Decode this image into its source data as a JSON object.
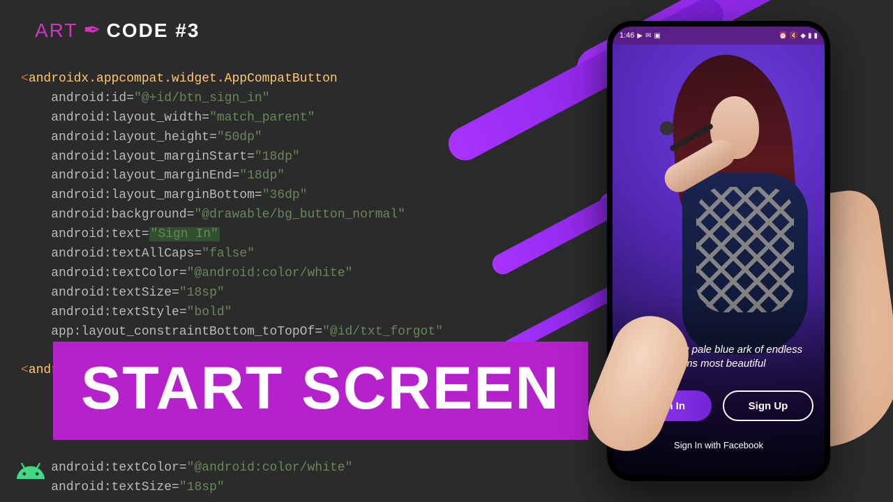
{
  "logo": {
    "art": "ART",
    "code": "CODE #3"
  },
  "code": {
    "open_tag": "androidx.appcompat.widget.AppCompatButton",
    "attrs": [
      {
        "name": "android:id",
        "value": "\"@+id/btn_sign_in\""
      },
      {
        "name": "android:layout_width",
        "value": "\"match_parent\""
      },
      {
        "name": "android:layout_height",
        "value": "\"50dp\""
      },
      {
        "name": "android:layout_marginStart",
        "value": "\"18dp\""
      },
      {
        "name": "android:layout_marginEnd",
        "value": "\"18dp\""
      },
      {
        "name": "android:layout_marginBottom",
        "value": "\"36dp\""
      },
      {
        "name": "android:background",
        "value": "\"@drawable/bg_button_normal\""
      },
      {
        "name": "android:text",
        "value": "\"Sign In\"",
        "highlight": true
      },
      {
        "name": "android:textAllCaps",
        "value": "\"false\""
      },
      {
        "name": "android:textColor",
        "value": "\"@android:color/white\""
      },
      {
        "name": "android:textSize",
        "value": "\"18sp\""
      },
      {
        "name": "android:textStyle",
        "value": "\"bold\""
      },
      {
        "name": "app:layout_constraintBottom_toTopOf",
        "value": "\"@id/txt_forgot\""
      }
    ],
    "second_tag": "androidx.appcompat.widget.AppCompatTextView",
    "tail_attrs": [
      {
        "name": "android:textColor",
        "value": "\"@android:color/white\""
      },
      {
        "name": "android:textSize",
        "value": "\"18sp\""
      }
    ]
  },
  "banner": {
    "title": "START SCREEN"
  },
  "phone": {
    "status_time": "1:46",
    "tagline": "Our floating pale blue ark of endless forms most beautiful",
    "sign_in": "Sign In",
    "sign_up": "Sign Up",
    "facebook": "Sign In with Facebook"
  }
}
